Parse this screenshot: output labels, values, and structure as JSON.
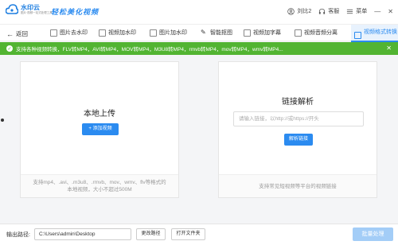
{
  "header": {
    "app_name": "水印云",
    "app_subtitle": "图片·视频一站式处理工具",
    "slogan": "轻松美化视频",
    "user_label": "刘比2",
    "service_label": "客服",
    "menu_label": "菜单",
    "minimize_glyph": "—",
    "close_glyph": "✕"
  },
  "toolbar": {
    "back_label": "返回",
    "tools": [
      {
        "label": "图片去水印"
      },
      {
        "label": "视频加水印"
      },
      {
        "label": "图片加水印"
      },
      {
        "label": "智能抠图"
      },
      {
        "label": "视频加字幕"
      },
      {
        "label": "视频音频分离"
      },
      {
        "label": "视频格式转换"
      }
    ],
    "active_index": 6
  },
  "notice": {
    "text": "支持各种视频转换，FLV转MP4，AVI转MP4，MOV转MP4，M3U8转MP4，rmvb转MP4，mov转MP4，wmv转MP4...",
    "close_glyph": "✕"
  },
  "local_upload": {
    "title": "本地上传",
    "add_button": "+ 添加视频",
    "footer_line1": "支持mp4、.avi、.m3u8、.rmvb、mov、wmv、flv等格式的",
    "footer_line2": "本地视频，大小不超过500M"
  },
  "link_parse": {
    "title": "链接解析",
    "input_placeholder": "请输入链接，以http://或https://开头",
    "parse_button": "解析链接",
    "footer": "支持常见短视频等平台的视频链接"
  },
  "bottom": {
    "output_label": "输出路径:",
    "output_path": "C:\\Users\\admin\\Desktop",
    "change_path": "更改路径",
    "open_folder": "打开文件夹",
    "batch_button": "批量处理"
  },
  "colors": {
    "accent": "#2b8bf0",
    "notice_green": "#52b432",
    "batch_disabled": "#a3cdf7"
  }
}
